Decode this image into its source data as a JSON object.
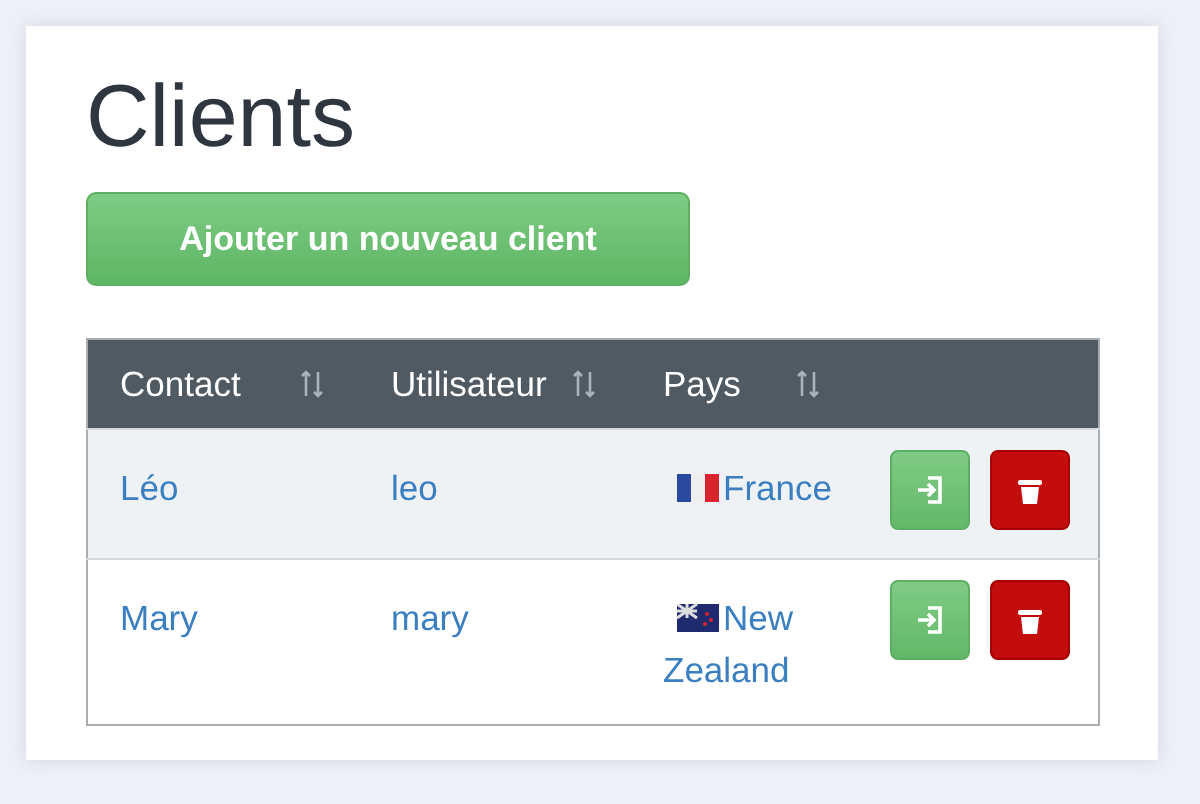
{
  "title": "Clients",
  "add_button": "Ajouter un nouveau client",
  "table": {
    "columns": [
      {
        "label": "Contact",
        "sortable": true
      },
      {
        "label": "Utilisateur",
        "sortable": true
      },
      {
        "label": "Pays",
        "sortable": true
      }
    ],
    "rows": [
      {
        "contact": "Léo",
        "user": "leo",
        "country": "France",
        "kind": "tricolor"
      },
      {
        "contact": "Mary",
        "user": "mary",
        "country": "New Zealand",
        "kind": "ensign"
      }
    ]
  }
}
